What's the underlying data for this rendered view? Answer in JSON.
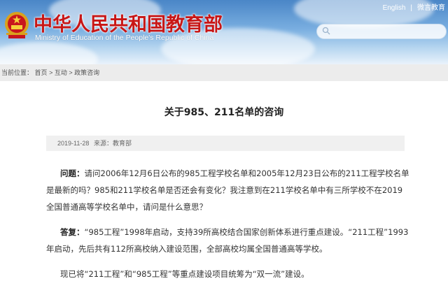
{
  "header": {
    "title": "中华人民共和国教育部",
    "subtitle": "Ministry of Education of the People's Republic of China",
    "links": [
      "English",
      "微言教育"
    ],
    "search_placeholder": ""
  },
  "breadcrumb": {
    "prefix": "当前位置：",
    "items": [
      "首页",
      "互动",
      "政策咨询"
    ],
    "separator": ">"
  },
  "article": {
    "title": "关于985、211名单的咨询",
    "date": "2019-11-28",
    "source": "来源：教育部",
    "question_label": "问题：",
    "question": "请问2006年12月6日公布的985工程学校名单和2005年12月23日公布的211工程学校名单是最新的吗？985和211学校名单是否还会有变化？我注意到在211学校名单中有三所学校不在2019全国普通高等学校名单中，请问是什么意思？",
    "answer_label": "答复：",
    "answer": "“985工程”1998年启动，支持39所高校结合国家创新体系进行重点建设。“211工程”1993年启动，先后共有112所高校纳入建设范围，全部高校均属全国普通高等学校。",
    "note": "现已将“211工程”和“985工程”等重点建设项目统筹为“双一流”建设。"
  },
  "colors": {
    "title_red": "#c81616",
    "banner_blue": "#4a86c7"
  }
}
